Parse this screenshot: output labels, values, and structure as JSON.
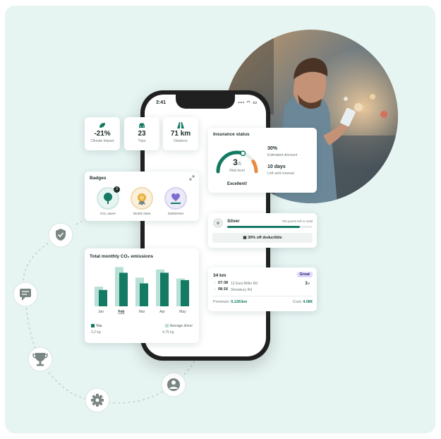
{
  "colors": {
    "accent": "#157a63",
    "accent_light": "#b7e0d6",
    "orange": "#e98a3f",
    "background": "#e6f4f2",
    "great_badge_bg": "#dfdafc"
  },
  "phone": {
    "time": "3:41",
    "signal": "▪▪▪ ◠ ▭"
  },
  "stats": [
    {
      "icon": "leaf-icon",
      "value": "-21%",
      "label": "Climate Impact"
    },
    {
      "icon": "car-icon",
      "value": "23",
      "label": "Trips"
    },
    {
      "icon": "road-icon",
      "value": "71 km",
      "label": "Distance"
    }
  ],
  "insurance": {
    "title": "Insurance status",
    "risk_value": "3",
    "risk_max": "/5",
    "risk_label": "Risk level",
    "risk_fraction": 0.6,
    "rating": "Excellent!",
    "discount_value": "30%",
    "discount_label": "Estimated discount",
    "renewal_value": "10 days",
    "renewal_label": "Left until renewal"
  },
  "badges": {
    "title": "Badges",
    "expand_icon": "expand-icon",
    "items": [
      {
        "label": "CO₂ saver",
        "count": "3"
      },
      {
        "label": "World class",
        "count": ""
      },
      {
        "label": "SafeDriver",
        "count": ""
      }
    ]
  },
  "tier": {
    "name": "Silver",
    "points_text": "700 points left to Gold",
    "progress": 0.85,
    "deductible_text": "30% off deductible"
  },
  "trip": {
    "distance": "34 km",
    "rating": "Great",
    "start_time": "07:38",
    "start_place": "12 East Miller Rd",
    "end_time": "08:16",
    "end_place": "Shewbury Rd",
    "score": "3",
    "score_max": "/5",
    "premium_label": "Premium:",
    "premium_value": "0,12€/km",
    "cost_label": "Cost:",
    "cost_value": "4.08€"
  },
  "emissions": {
    "title": "Total monthly CO₂ emissions",
    "legend_you": "You",
    "legend_you_value": "3,2 kg",
    "legend_avg": "Average driver",
    "legend_avg_value": "4,75 kg"
  },
  "chart_data": {
    "type": "bar",
    "title": "Total monthly CO₂ emissions",
    "categories": [
      "Jan",
      "Feb",
      "Mar",
      "Apr",
      "May"
    ],
    "selected": "Feb",
    "series": [
      {
        "name": "You",
        "values": [
          2.0,
          4.1,
          2.8,
          4.1,
          3.2
        ]
      },
      {
        "name": "Average driver",
        "values": [
          2.4,
          4.8,
          3.5,
          4.5,
          3.4
        ]
      }
    ],
    "ylim": [
      0,
      5
    ],
    "grid": false,
    "legend": "bottom"
  },
  "orbit_icons": [
    "shield-check-icon",
    "chat-icon",
    "trophy-icon",
    "gear-icon",
    "user-icon"
  ]
}
